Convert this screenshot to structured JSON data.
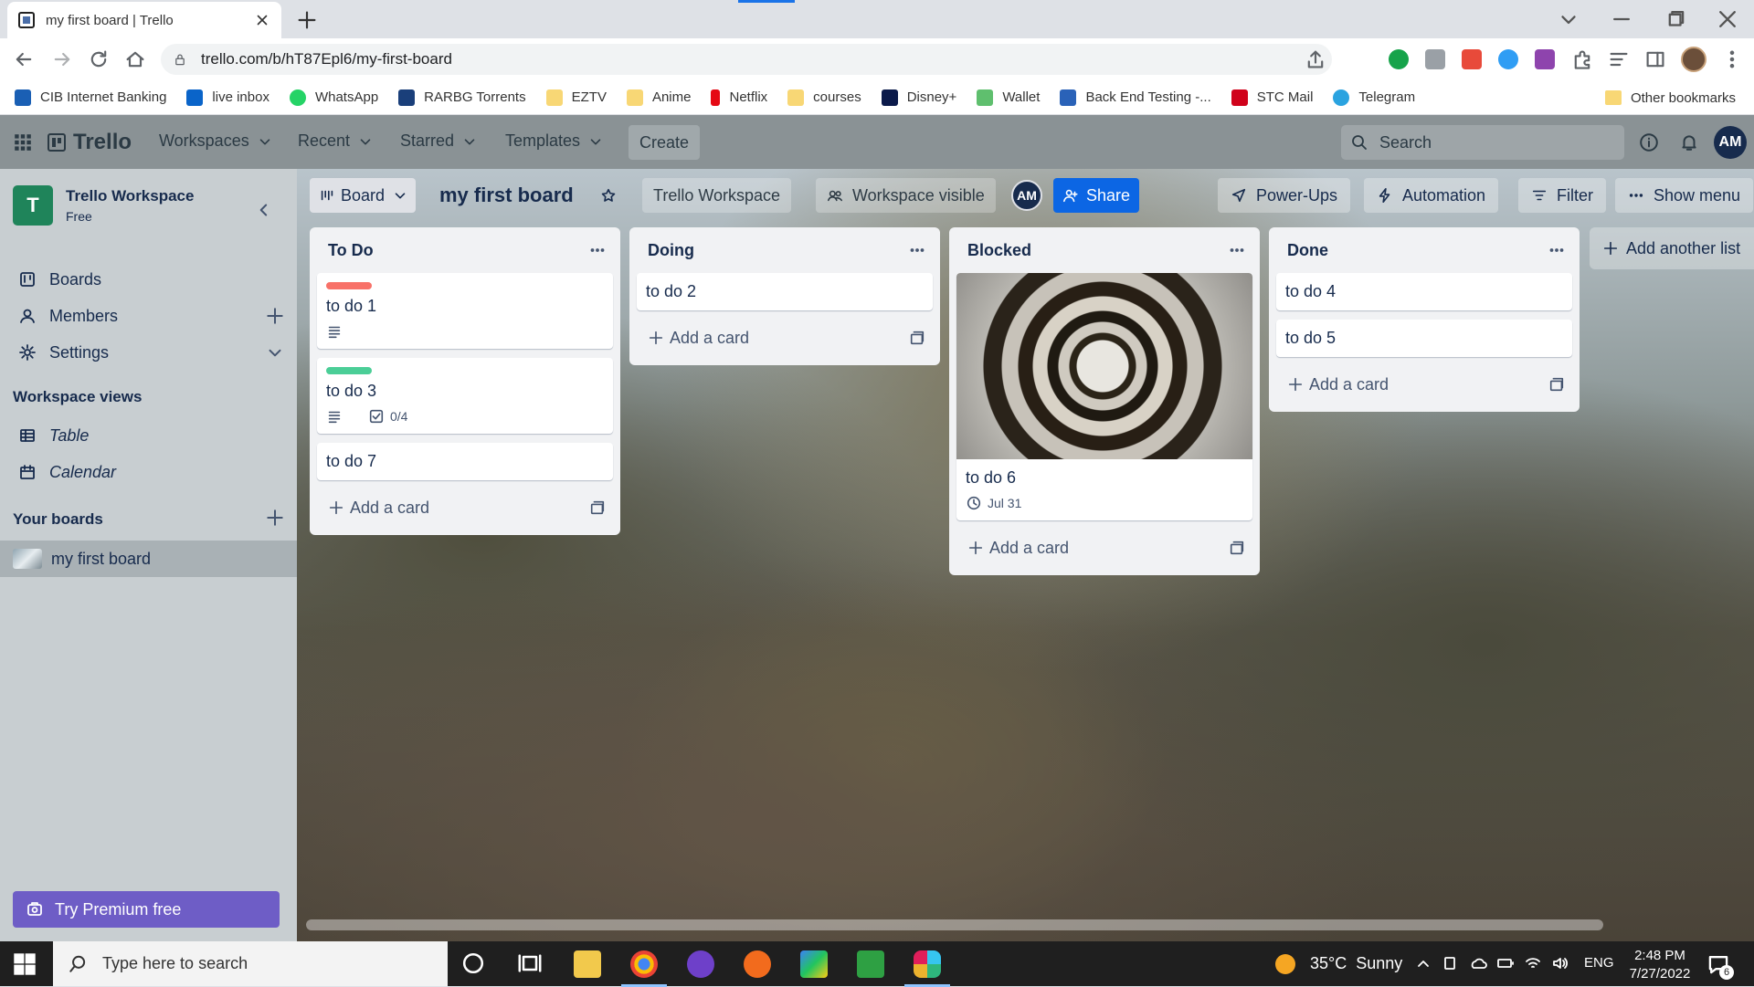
{
  "browser": {
    "tab_title": "my first board | Trello",
    "url": "trello.com/b/hT87Epl6/my-first-board"
  },
  "bookmarks": {
    "items": [
      {
        "label": "CIB Internet Banking",
        "icon": "bank-icon",
        "color": "#1a5fb4"
      },
      {
        "label": "live inbox",
        "icon": "outlook-icon",
        "color": "#0a64c9"
      },
      {
        "label": "WhatsApp",
        "icon": "whatsapp-icon",
        "color": "#25d366"
      },
      {
        "label": "RARBG Torrents",
        "icon": "rarbg-icon",
        "color": "#1a3f7a"
      },
      {
        "label": "EZTV",
        "icon": "folder-icon",
        "color": "#f8d775"
      },
      {
        "label": "Anime",
        "icon": "folder-icon",
        "color": "#f8d775"
      },
      {
        "label": "Netflix",
        "icon": "netflix-icon",
        "color": "#e50914"
      },
      {
        "label": "courses",
        "icon": "folder-icon",
        "color": "#f8d775"
      },
      {
        "label": "Disney+",
        "icon": "disney-icon",
        "color": "#0b1a4a"
      },
      {
        "label": "Wallet",
        "icon": "wallet-icon",
        "color": "#5fbf6e"
      },
      {
        "label": "Back End Testing -...",
        "icon": "testing-icon",
        "color": "#2a62b8"
      },
      {
        "label": "STC Mail",
        "icon": "stc-icon",
        "color": "#d0021b"
      },
      {
        "label": "Telegram",
        "icon": "telegram-icon",
        "color": "#2aa3e0"
      }
    ],
    "other": "Other bookmarks"
  },
  "header": {
    "logo": "Trello",
    "menus": [
      "Workspaces",
      "Recent",
      "Starred",
      "Templates"
    ],
    "create": "Create",
    "search_placeholder": "Search",
    "avatar": "AM"
  },
  "sidebar": {
    "workspace_initial": "T",
    "workspace_name": "Trello Workspace",
    "workspace_plan": "Free",
    "nav": [
      "Boards",
      "Members",
      "Settings"
    ],
    "views_heading": "Workspace views",
    "views": [
      "Table",
      "Calendar"
    ],
    "boards_heading": "Your boards",
    "boards": [
      "my first board"
    ],
    "premium": "Try Premium free"
  },
  "board": {
    "view": "Board",
    "title": "my first board",
    "workspace": "Trello Workspace",
    "visibility": "Workspace visible",
    "member": "AM",
    "share": "Share",
    "powerups": "Power-Ups",
    "automation": "Automation",
    "filter": "Filter",
    "show_menu": "Show menu",
    "add_list": "Add another list",
    "add_card": "Add a card",
    "lists": [
      {
        "title": "To Do",
        "cards": [
          {
            "title": "to do 1",
            "label_color": "#f87168",
            "has_description": true
          },
          {
            "title": "to do 3",
            "label_color": "#4bce97",
            "has_description": true,
            "checklist": "0/4"
          },
          {
            "title": "to do 7"
          }
        ]
      },
      {
        "title": "Doing",
        "cards": [
          {
            "title": "to do 2"
          }
        ]
      },
      {
        "title": "Blocked",
        "cards": [
          {
            "title": "to do 6",
            "has_cover": true,
            "due": "Jul 31"
          }
        ]
      },
      {
        "title": "Done",
        "cards": [
          {
            "title": "to do 4"
          },
          {
            "title": "to do 5"
          }
        ]
      }
    ]
  },
  "taskbar": {
    "search_placeholder": "Type here to search",
    "temperature": "35°C",
    "weather": "Sunny",
    "language": "ENG",
    "time": "2:48 PM",
    "date": "7/27/2022",
    "notifications": "6"
  }
}
